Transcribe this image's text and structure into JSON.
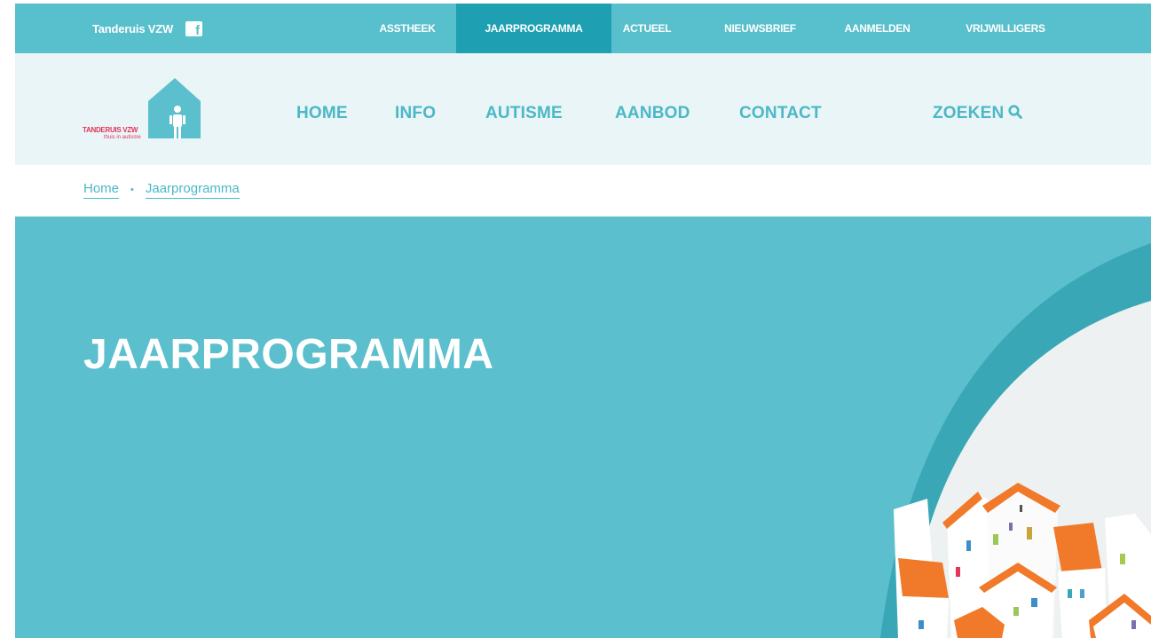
{
  "topbar": {
    "brand": "Tanderuis VZW",
    "facebook_icon": "facebook-icon",
    "items": [
      {
        "label": "ASSTHEEK",
        "active": false
      },
      {
        "label": "JAARPROGRAMMA",
        "active": true
      },
      {
        "label": "ACTUEEL",
        "active": false
      },
      {
        "label": "NIEUWSBRIEF",
        "active": false
      },
      {
        "label": "AANMELDEN",
        "active": false
      },
      {
        "label": "VRIJWILLIGERS",
        "active": false
      }
    ]
  },
  "logo": {
    "name": "TANDERUIS VZW",
    "tagline": "thuis in autisme"
  },
  "mainnav": {
    "items": [
      "HOME",
      "INFO",
      "AUTISME",
      "AANBOD",
      "CONTACT"
    ],
    "search_label": "ZOEKEN",
    "search_icon": "search-icon"
  },
  "breadcrumb": {
    "items": [
      "Home",
      "Jaarprogramma"
    ],
    "separator": "•"
  },
  "hero": {
    "title": "JAARPROGRAMMA"
  },
  "colors": {
    "topbar": "#58bfcc",
    "topbar_active": "#1e9fb2",
    "header_bg": "#e9f5f7",
    "nav_text": "#4cb7c6",
    "hero_bg": "#5bbfcd",
    "logo_red": "#e6345a",
    "roof_orange": "#f07a2a"
  }
}
